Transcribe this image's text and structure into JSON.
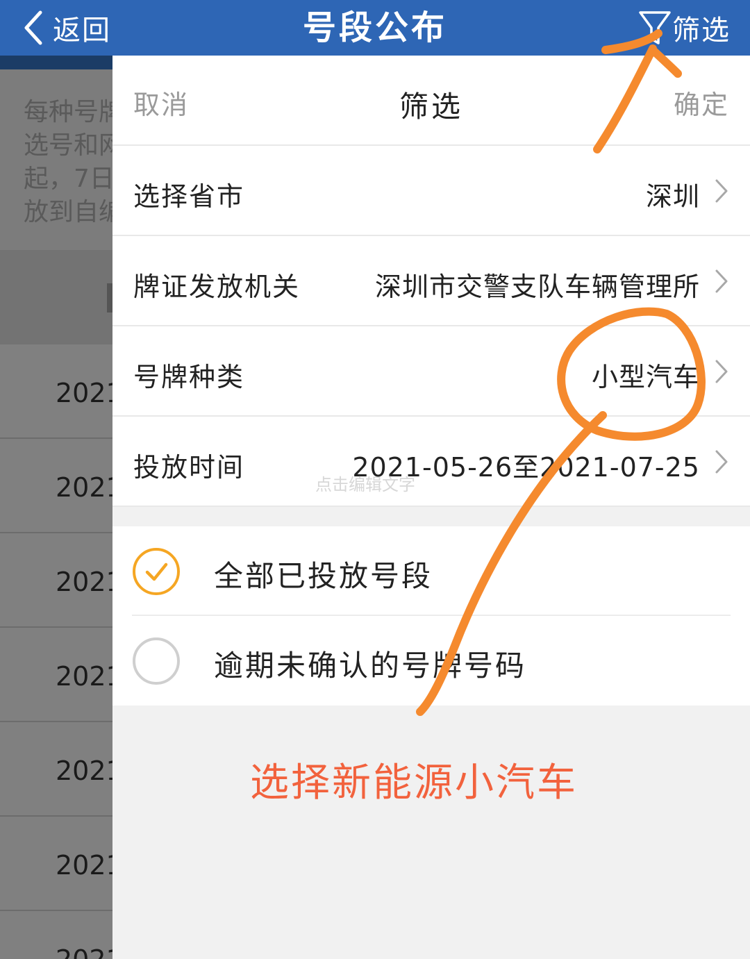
{
  "navbar": {
    "back_label": "返回",
    "title": "号段公布",
    "filter_label": "筛选",
    "color": "#2e66b5"
  },
  "background": {
    "notice_lines": [
      "每种号牌",
      "选号和网",
      "起，7日",
      "放到自编"
    ],
    "rows": [
      "2021",
      "2021",
      "2021",
      "2021",
      "2021",
      "2021",
      "2021"
    ]
  },
  "panel": {
    "cancel_label": "取消",
    "title": "筛选",
    "confirm_label": "确定",
    "rows": [
      {
        "label": "选择省市",
        "value": "深圳"
      },
      {
        "label": "牌证发放机关",
        "value": "深圳市交警支队车辆管理所"
      },
      {
        "label": "号牌种类",
        "value": "小型汽车"
      },
      {
        "label": "投放时间",
        "value": "2021-05-26至2021-07-25"
      }
    ],
    "options": [
      {
        "label": "全部已投放号段",
        "selected": true
      },
      {
        "label": "逾期未确认的号牌号码",
        "selected": false
      }
    ],
    "accent": "#f5a623"
  },
  "watermark": "点击编辑文字",
  "annotation": {
    "text": "选择新能源小汽车",
    "color": "#f2623d",
    "stroke_color": "#f58a2e"
  }
}
